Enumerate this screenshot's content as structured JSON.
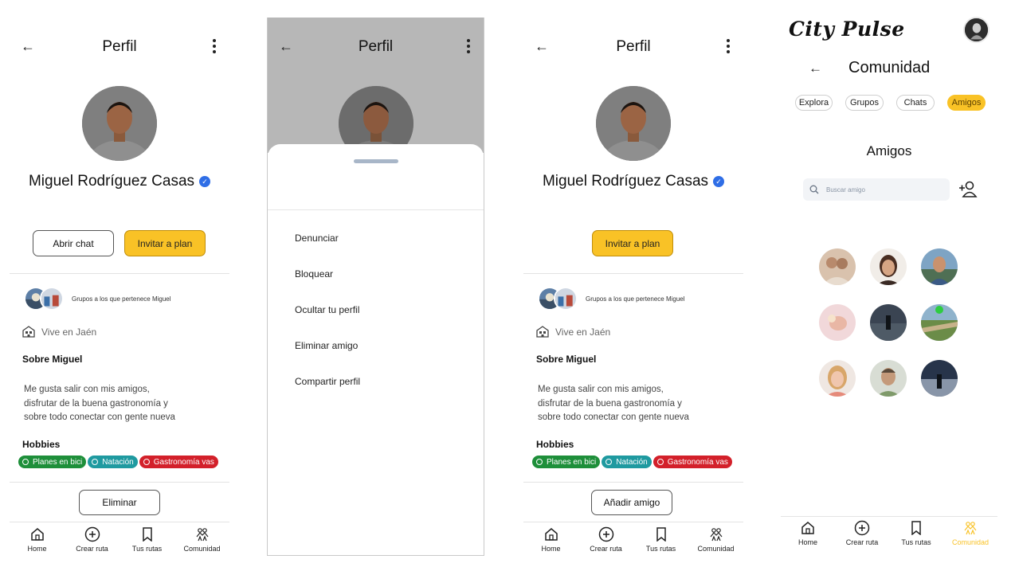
{
  "profile": {
    "title": "Perfil",
    "name": "Miguel Rodríguez Casas",
    "verified_mark": "✓",
    "btn_chat": "Abrir chat",
    "btn_invite": "Invitar a plan",
    "groups_text": "Grupos a los que pertenece Miguel",
    "lives": "Vive en Jaén",
    "about_heading": "Sobre Miguel",
    "about_lines": [
      "Me gusta salir con mis amigos,",
      "disfrutar de la buena gastronomía y",
      "sobre todo conectar con gente nueva"
    ],
    "hobbies_heading": "Hobbies",
    "hobbies": [
      {
        "label": "Planes en bici",
        "color": "#1e8f3a"
      },
      {
        "label": "Natación",
        "color": "#1f9aa0"
      },
      {
        "label": "Gastronomía vas",
        "color": "#d3202a"
      }
    ],
    "btn_remove": "Eliminar",
    "btn_add": "Añadir amigo"
  },
  "options_sheet": {
    "items": [
      "Denunciar",
      "Bloquear",
      "Ocultar tu perfil",
      "Eliminar amigo",
      "Compartir perfil"
    ]
  },
  "community": {
    "brand": "City Pulse",
    "title": "Comunidad",
    "tabs": [
      {
        "label": "Explora",
        "active": false
      },
      {
        "label": "Grupos",
        "active": false
      },
      {
        "label": "Chats",
        "active": false
      },
      {
        "label": "Amigos",
        "active": true
      }
    ],
    "section_title": "Amigos",
    "search_placeholder": "Buscar amigo"
  },
  "bottom_nav": [
    {
      "label": "Home",
      "icon": "home-icon"
    },
    {
      "label": "Crear ruta",
      "icon": "plus-circle-icon"
    },
    {
      "label": "Tus rutas",
      "icon": "bookmark-icon"
    },
    {
      "label": "Comunidad",
      "icon": "people-icon"
    }
  ],
  "colors": {
    "accent_yellow": "#f9c226",
    "verified_blue": "#2f6ee6",
    "active_nav": "#f9c226",
    "online": "#2ecc40"
  }
}
